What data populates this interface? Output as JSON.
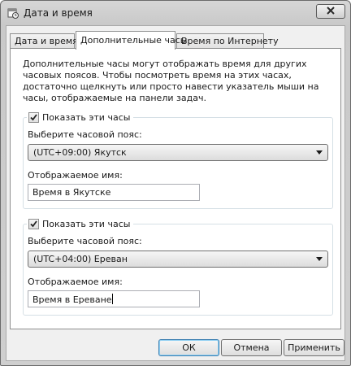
{
  "window": {
    "title": "Дата и время"
  },
  "tabs": [
    {
      "label": "Дата и время",
      "active": false
    },
    {
      "label": "Дополнительные часы",
      "active": true
    },
    {
      "label": "Время по Интернету",
      "active": false
    }
  ],
  "panel": {
    "description": "Дополнительные часы могут отображать время для других часовых поясов. Чтобы посмотреть время на этих часах, достаточно щелкнуть или просто навести указатель мыши на часы, отображаемые на панели задач."
  },
  "clocks": [
    {
      "show_label": "Показать эти часы",
      "checked": true,
      "timezone_label": "Выберите часовой пояс:",
      "timezone_value": "(UTC+09:00) Якутск",
      "display_name_label": "Отображаемое имя:",
      "display_name_value": "Время в Якутске"
    },
    {
      "show_label": "Показать эти часы",
      "checked": true,
      "timezone_label": "Выберите часовой пояс:",
      "timezone_value": "(UTC+04:00) Ереван",
      "display_name_label": "Отображаемое имя:",
      "display_name_value": "Время в Ереване"
    }
  ],
  "buttons": {
    "ok": "ОК",
    "cancel": "Отмена",
    "apply": "Применить"
  },
  "icons": {
    "app": "calendar-clock-icon",
    "close": "close-icon",
    "check": "checkmark-icon",
    "dropdown": "dropdown-arrow-icon"
  }
}
